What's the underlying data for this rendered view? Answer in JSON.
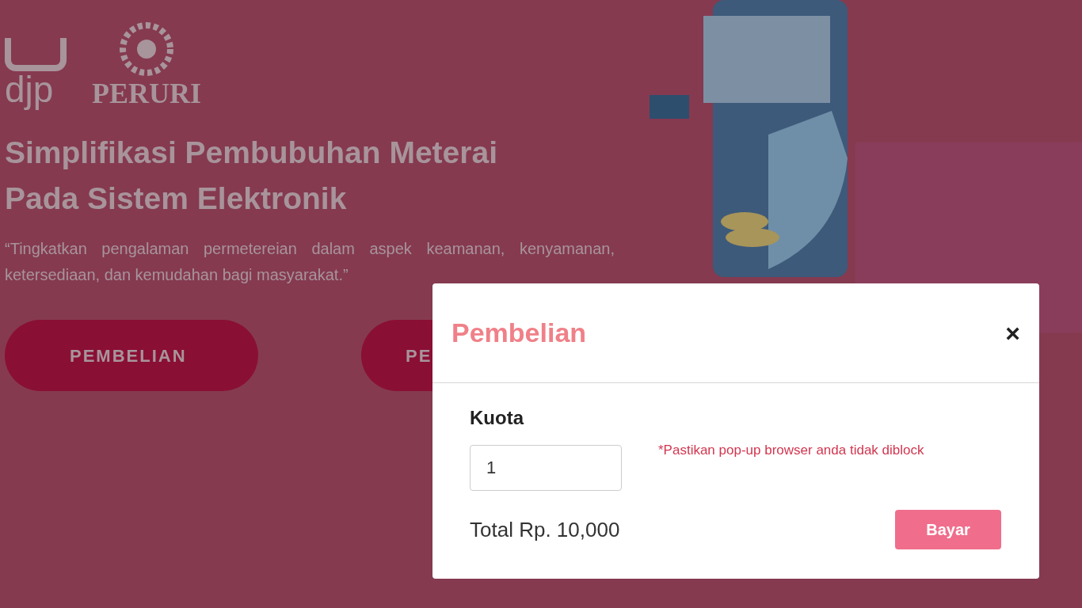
{
  "logos": {
    "djp": "djp",
    "peruri": "PERURI"
  },
  "hero": {
    "title_lines": [
      "Simplifikasi Pembubuhan Meterai",
      "Pada Sistem Elektronik"
    ],
    "quote": "“Tingkatkan pengalaman permetereian dalam aspek keamanan, kenyamanan, ketersediaan, dan kemudahan bagi masyarakat.”"
  },
  "buttons": [
    "PEMBELIAN",
    "PE"
  ],
  "modal": {
    "title": "Pembelian",
    "close": "×",
    "field_label": "Kuota",
    "field_value": "1",
    "note": "*Pastikan pop-up browser anda tidak diblock",
    "total": "Total Rp. 10,000",
    "submit": "Bayar"
  }
}
